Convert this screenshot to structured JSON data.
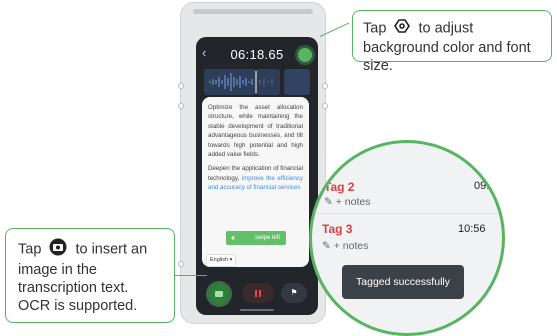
{
  "recording": {
    "timer": "06:18.65",
    "paragraph1": "Optimize the asset allocation structure, while maintaining the stable development of traditional advantageous businesses, and tilt towards high potential and high added value fields.",
    "paragraph2_start": "Deepen the application of financial technology, ",
    "paragraph2_link": "improve the efficiency and accuracy of financial services",
    "swipe_label": "swipe left",
    "language": "English"
  },
  "callout_top": {
    "before": "Tap",
    "after": "to adjust background color and font size."
  },
  "callout_bottom": {
    "before": "Tap",
    "after": "to insert an image in the transcription text. OCR is supported."
  },
  "magnifier": {
    "tags": [
      {
        "label": "Tag 2",
        "time": "09:",
        "notes": "+ notes"
      },
      {
        "label": "Tag 3",
        "time": "10:56",
        "notes": "+ notes"
      }
    ],
    "toast": "Tagged successfully"
  },
  "colors": {
    "accent": "#57b461",
    "tag_red": "#d8413f",
    "link_blue": "#3a8ee6"
  },
  "icons": [
    "back-arrow-icon",
    "settings-icon",
    "camera-icon",
    "pause-icon",
    "flag-icon",
    "edit-icon",
    "double-chevron-left-icon"
  ]
}
